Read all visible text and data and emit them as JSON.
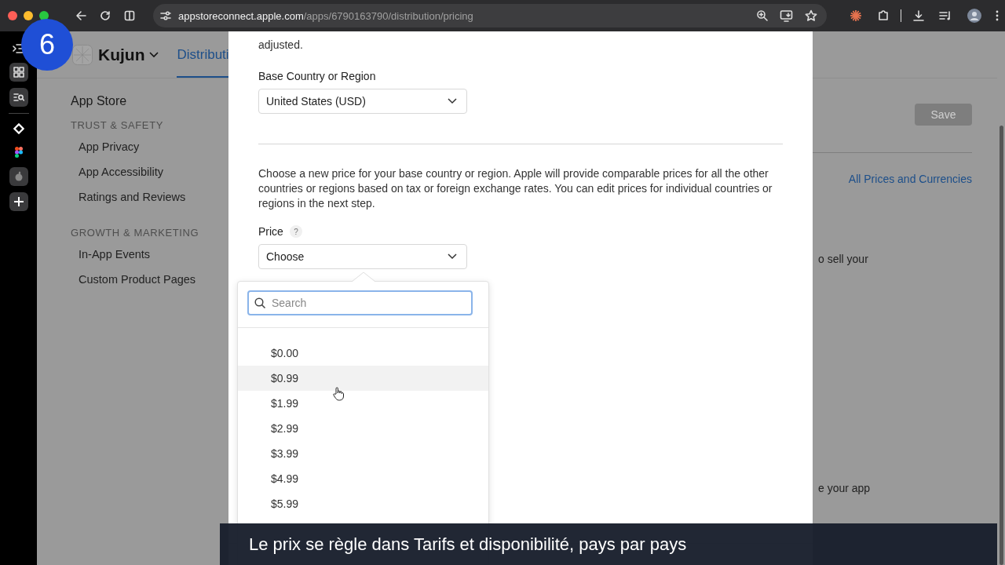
{
  "browser": {
    "url_host": "appstoreconnect.apple.com",
    "url_path": "/apps/6790163790/distribution/pricing"
  },
  "step_badge": "6",
  "app": {
    "name": "Kujun",
    "tab": "Distributi"
  },
  "sidebar": {
    "title": "App Store",
    "sections": [
      {
        "heading": "TRUST & SAFETY",
        "items": [
          {
            "label": "App Privacy",
            "selected": false
          },
          {
            "label": "App Accessibility",
            "selected": false
          },
          {
            "label": "Ratings and Reviews",
            "selected": false
          }
        ]
      },
      {
        "heading": "GROWTH & MARKETING",
        "items": [
          {
            "label": "In-App Events",
            "selected": false
          },
          {
            "label": "Custom Product Pages",
            "selected": false
          }
        ]
      }
    ]
  },
  "page": {
    "save_button": {
      "label": "Save",
      "disabled": true
    },
    "link": "All Prices and Currencies",
    "fragments": [
      "o sell your",
      "e your app"
    ]
  },
  "modal": {
    "intro_tail": "adjusted.",
    "base_label": "Base Country or Region",
    "base_value": "United States (USD)",
    "description": "Choose a new price for your base country or region. Apple will provide comparable prices for all the other countries or regions based on tax or foreign exchange rates. You can edit prices for individual countries or regions in the next step.",
    "price_label": "Price",
    "help": "?",
    "price_value": "Choose"
  },
  "price_menu": {
    "search_placeholder": "Search",
    "options": [
      {
        "label": "$0.00",
        "hovered": false
      },
      {
        "label": "$0.99",
        "hovered": true
      },
      {
        "label": "$1.99",
        "hovered": false
      },
      {
        "label": "$2.99",
        "hovered": false
      },
      {
        "label": "$3.99",
        "hovered": false
      },
      {
        "label": "$4.99",
        "hovered": false
      },
      {
        "label": "$5.99",
        "hovered": false
      }
    ]
  },
  "caption": "Le prix se règle dans Tarifs et disponibilité, pays par pays"
}
